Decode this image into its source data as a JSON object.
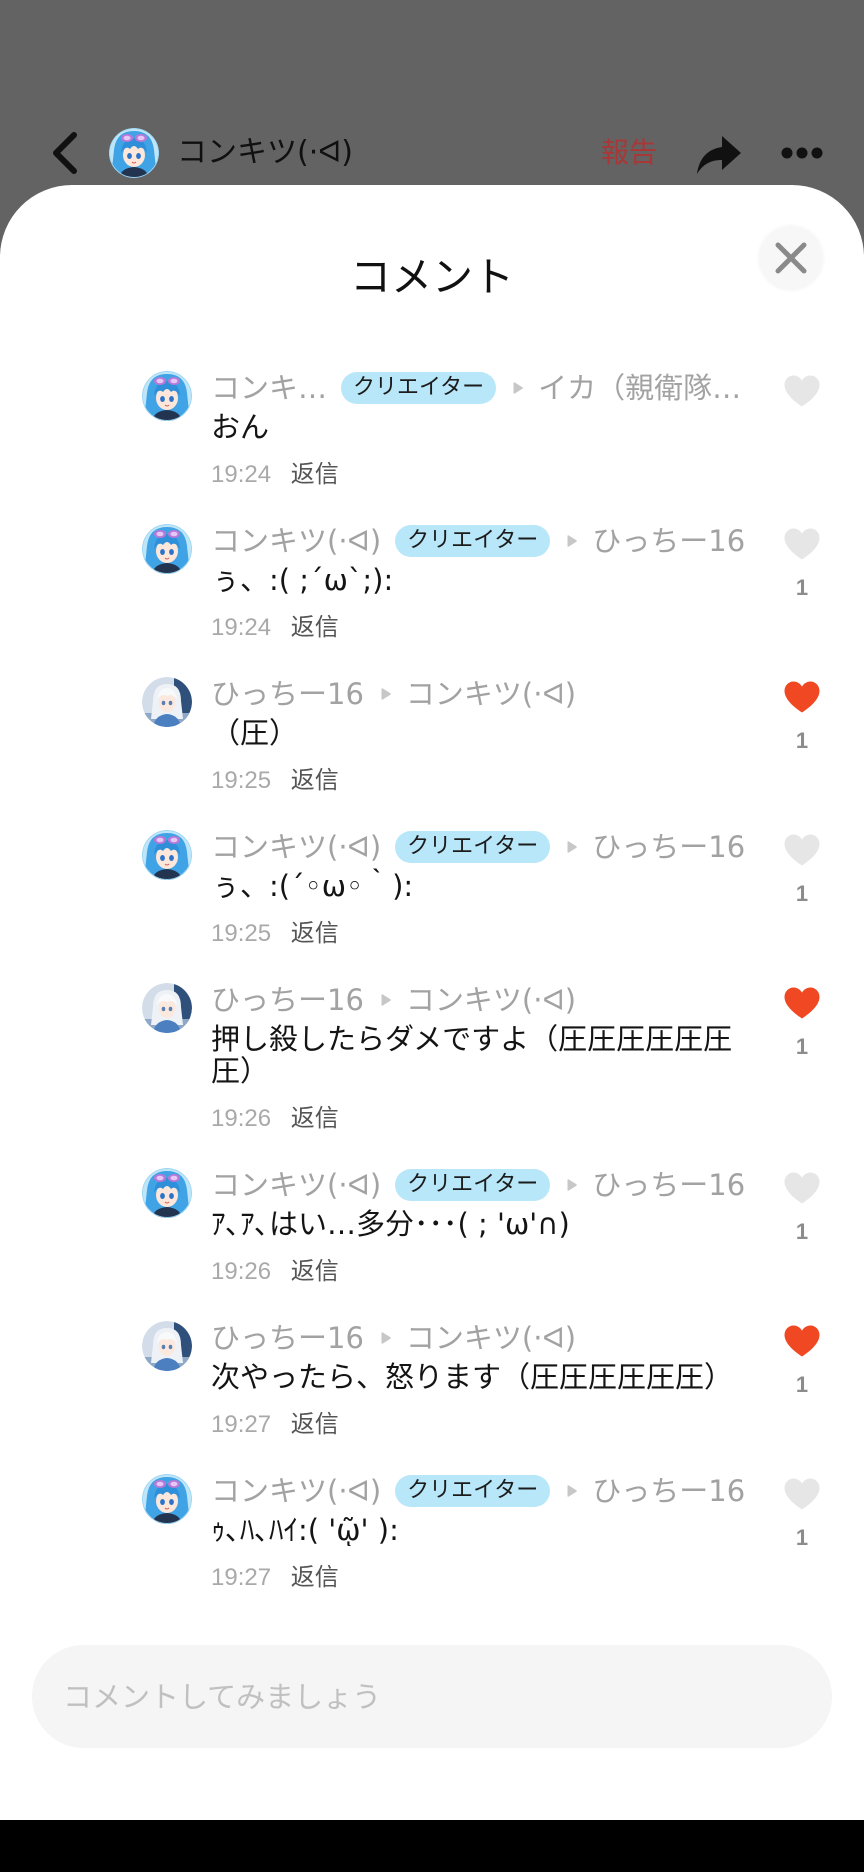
{
  "header": {
    "back_icon": "chevron-left-icon",
    "avatar": "blue-hair-avatar",
    "user_name": "コンキツ(·ᐊ)",
    "report_label": "報告",
    "share_icon": "share-icon",
    "more_icon": "more-dots-icon"
  },
  "sheet": {
    "title": "コメント",
    "close_icon": "close-icon"
  },
  "reply_label": "返信",
  "reply_arrow_icon": "reply-arrow-icon",
  "like_icon": "heart-icon",
  "comments": [
    {
      "author": "コンキ…",
      "avatar": "blue-hair-avatar",
      "badge": "クリエイター",
      "reply_to": "イカ（親衛隊…",
      "text": "おん",
      "time": "19:24",
      "liked": false
    },
    {
      "author": "コンキツ(·ᐊ)",
      "avatar": "blue-hair-avatar",
      "badge": "クリエイター",
      "reply_to": "ひっちー16",
      "text": "ぅ、:( ;´ω`;):",
      "time": "19:24",
      "liked": false,
      "like_count": 1
    },
    {
      "author": "ひっちー16",
      "avatar": "white-hair-avatar",
      "reply_to": "コンキツ(·ᐊ)",
      "text": "（圧）",
      "time": "19:25",
      "liked": true,
      "like_count": 1
    },
    {
      "author": "コンキツ(·ᐊ)",
      "avatar": "blue-hair-avatar",
      "badge": "クリエイター",
      "reply_to": "ひっちー16",
      "text": "ぅ、:(´◦ω◦｀):",
      "time": "19:25",
      "liked": false,
      "like_count": 1
    },
    {
      "author": "ひっちー16",
      "avatar": "white-hair-avatar",
      "reply_to": "コンキツ(·ᐊ)",
      "text": "押し殺したらダメですよ（圧圧圧圧圧圧圧）",
      "time": "19:26",
      "liked": true,
      "like_count": 1
    },
    {
      "author": "コンキツ(·ᐊ)",
      "avatar": "blue-hair-avatar",
      "badge": "クリエイター",
      "reply_to": "ひっちー16",
      "text": "ｱ､ｱ､はい…多分･･･( ; 'ω'∩)",
      "time": "19:26",
      "liked": false,
      "like_count": 1
    },
    {
      "author": "ひっちー16",
      "avatar": "white-hair-avatar",
      "reply_to": "コンキツ(·ᐊ)",
      "text": "次やったら、怒ります（圧圧圧圧圧圧）",
      "time": "19:27",
      "liked": true,
      "like_count": 1
    },
    {
      "author": "コンキツ(·ᐊ)",
      "avatar": "blue-hair-avatar",
      "badge": "クリエイター",
      "reply_to": "ひっちー16",
      "text": "ｩ､ﾊ､ﾊｲ:( 'ῷ' ):",
      "time": "19:27",
      "liked": false,
      "like_count": 1
    }
  ],
  "composer": {
    "placeholder": "コメントしてみましょう"
  },
  "colors": {
    "like_active": "#f04822",
    "like_inactive": "#e6e6e6",
    "creator_badge": "#b8e7f9",
    "report_text": "#a83838",
    "scrim": "#636363"
  }
}
